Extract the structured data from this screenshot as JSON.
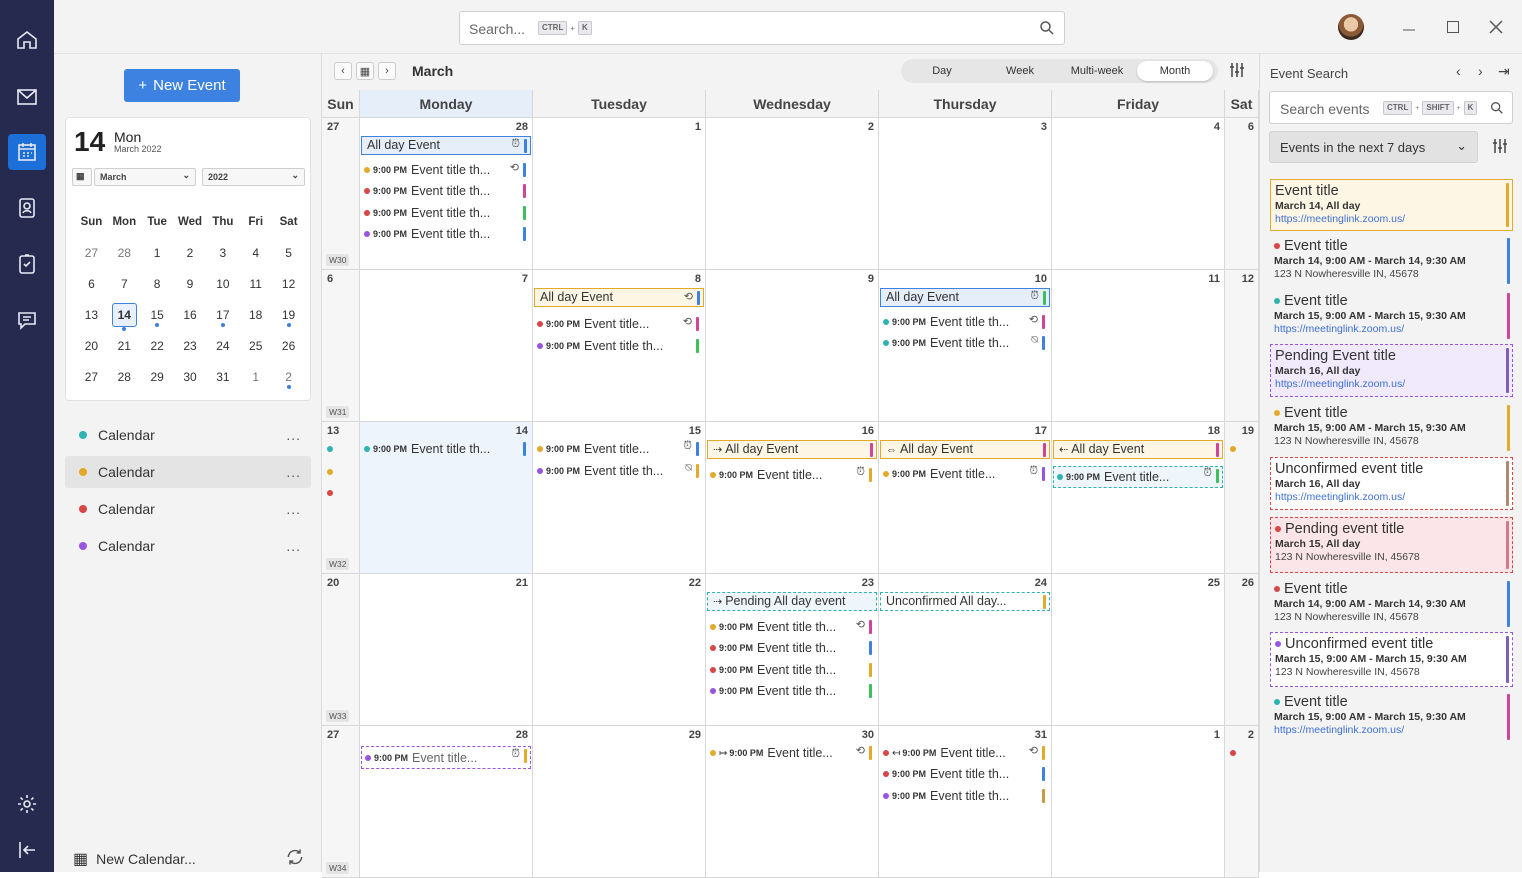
{
  "search": {
    "placeholder": "Search...",
    "key1": "CTRL",
    "key2": "K"
  },
  "sidebar": {
    "new_event": "New Event",
    "mini": {
      "day": "14",
      "weekday": "Mon",
      "sub": "March 2022",
      "month_select": "March",
      "year_select": "2022",
      "headers": [
        "Sun",
        "Mon",
        "Tue",
        "Wed",
        "Thu",
        "Fri",
        "Sat"
      ],
      "weeks": [
        [
          "27",
          "28",
          "1",
          "2",
          "3",
          "4",
          "5"
        ],
        [
          "6",
          "7",
          "8",
          "9",
          "10",
          "11",
          "12"
        ],
        [
          "13",
          "14",
          "15",
          "16",
          "17",
          "18",
          "19"
        ],
        [
          "20",
          "21",
          "22",
          "23",
          "24",
          "25",
          "26"
        ],
        [
          "27",
          "28",
          "29",
          "30",
          "31",
          "1",
          "2"
        ]
      ]
    },
    "calendars": [
      {
        "label": "Calendar",
        "color": "#2fb3b0"
      },
      {
        "label": "Calendar",
        "color": "#e5a92a"
      },
      {
        "label": "Calendar",
        "color": "#d84646"
      },
      {
        "label": "Calendar",
        "color": "#9a55e0"
      }
    ],
    "more": "...",
    "new_calendar": "New Calendar..."
  },
  "toolbar": {
    "month": "March",
    "views": [
      "Day",
      "Week",
      "Multi-week",
      "Month"
    ]
  },
  "days": [
    "Sun",
    "Monday",
    "Tuesday",
    "Wednesday",
    "Thursday",
    "Friday",
    "Sat"
  ],
  "weeks": [
    {
      "label": "W30",
      "nums": [
        "27",
        "28",
        "1",
        "2",
        "3",
        "4",
        "6"
      ]
    },
    {
      "label": "W31",
      "nums": [
        "6",
        "7",
        "8",
        "9",
        "10",
        "11",
        "12"
      ]
    },
    {
      "label": "W32",
      "nums": [
        "13",
        "14",
        "15",
        "16",
        "17",
        "18",
        "19"
      ]
    },
    {
      "label": "W33",
      "nums": [
        "20",
        "21",
        "22",
        "23",
        "24",
        "25",
        "26"
      ]
    },
    {
      "label": "W34",
      "nums": [
        "27",
        "28",
        "29",
        "30",
        "31",
        "1",
        "2"
      ]
    }
  ],
  "events": {
    "time": "9:00 PM",
    "all_day": "All day Event",
    "t1": "Event title th...",
    "t2": "Event title...",
    "pending_all_day": "Pending All day event",
    "unconfirmed_all_day": "Unconfirmed All day..."
  },
  "colors": {
    "blue": "#3d82e0",
    "orange": "#e5a92a",
    "red": "#d84646",
    "green": "#3cbf5c",
    "purple": "#9a55e0",
    "teal": "#2fb3b0",
    "pink": "#d0459a",
    "gold": "#c79a44"
  },
  "right": {
    "title": "Event Search",
    "placeholder": "Search events",
    "k1": "CTRL",
    "k2": "SHIFT",
    "k3": "K",
    "filter": "Events in the next 7 days",
    "cards": [
      {
        "title": "Event title",
        "l2": "March 14, All day",
        "l3": "",
        "link": "https://meetinglink.zoom.us/"
      },
      {
        "title": "Event title",
        "l2": "March 14, 9:00 AM - March 14, 9:30 AM",
        "l3": "123 N Nowheresville IN, 45678",
        "link": ""
      },
      {
        "title": "Event title",
        "l2": "March 15, 9:00 AM - March 15, 9:30 AM",
        "l3": "",
        "link": "https://meetinglink.zoom.us/"
      },
      {
        "title": "Pending Event title",
        "l2": "March 16, All day",
        "l3": "",
        "link": "https://meetinglink.zoom.us/"
      },
      {
        "title": "Event title",
        "l2": "March 15, 9:00 AM - March 15, 9:30 AM",
        "l3": "123 N Nowheresville IN, 45678",
        "link": ""
      },
      {
        "title": "Unconfirmed event title",
        "l2": "March 16, All day",
        "l3": "",
        "link": "https://meetinglink.zoom.us/"
      },
      {
        "title": "Pending event title",
        "l2": "March 15, All day",
        "l3": "123 N Nowheresville IN, 45678",
        "link": ""
      },
      {
        "title": "Event title",
        "l2": "March 14, 9:00 AM - March 14, 9:30 AM",
        "l3": "123 N Nowheresville IN, 45678",
        "link": ""
      },
      {
        "title": "Unconfirmed event title",
        "l2": "March 15, 9:00 AM - March 15, 9:30 AM",
        "l3": "123 N Nowheresville IN, 45678",
        "link": ""
      },
      {
        "title": "Event title",
        "l2": "March 15, 9:00 AM - March 15, 9:30 AM",
        "l3": "",
        "link": "https://meetinglink.zoom.us/"
      }
    ]
  }
}
